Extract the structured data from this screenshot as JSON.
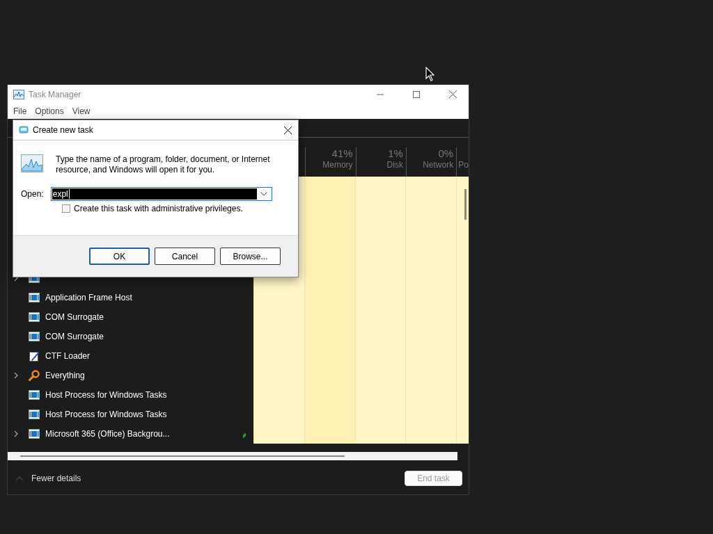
{
  "window": {
    "title": "Task Manager",
    "menu": [
      "File",
      "Options",
      "View"
    ]
  },
  "table": {
    "columns": [
      {
        "percent": "41%",
        "label": "Memory"
      },
      {
        "percent": "1%",
        "label": "Disk"
      },
      {
        "percent": "0%",
        "label": "Network"
      },
      {
        "label": "Po"
      }
    ],
    "rows": [
      {
        "kind": "app",
        "expandable": true,
        "efficiency_mode": false
      },
      {
        "name": "Application Frame Host",
        "kind": "app",
        "expandable": false,
        "efficiency_mode": false
      },
      {
        "name": "COM Surrogate",
        "kind": "app",
        "expandable": false,
        "efficiency_mode": false
      },
      {
        "name": "COM Surrogate",
        "kind": "app",
        "expandable": false,
        "efficiency_mode": false
      },
      {
        "name": "CTF Loader",
        "kind": "pen",
        "expandable": false,
        "efficiency_mode": false
      },
      {
        "name": "Everything",
        "kind": "magnifier",
        "expandable": true,
        "efficiency_mode": false
      },
      {
        "name": "Host Process for Windows Tasks",
        "kind": "app",
        "expandable": false,
        "efficiency_mode": false
      },
      {
        "name": "Host Process for Windows Tasks",
        "kind": "app",
        "expandable": false,
        "efficiency_mode": false
      },
      {
        "name": "Microsoft 365 (Office) Backgrou...",
        "kind": "app",
        "expandable": true,
        "efficiency_mode": true
      }
    ]
  },
  "footer": {
    "toggle": "Fewer details",
    "button": "End task"
  },
  "dialog": {
    "title": "Create new task",
    "message": "Type the name of a program, folder, document, or Internet resource, and Windows will open it for you.",
    "open_label": "Open:",
    "value": "expl",
    "admin_checkbox": {
      "label": "Create this task with administrative privileges.",
      "checked": false
    },
    "buttons": [
      "OK",
      "Cancel",
      "Browse..."
    ]
  }
}
